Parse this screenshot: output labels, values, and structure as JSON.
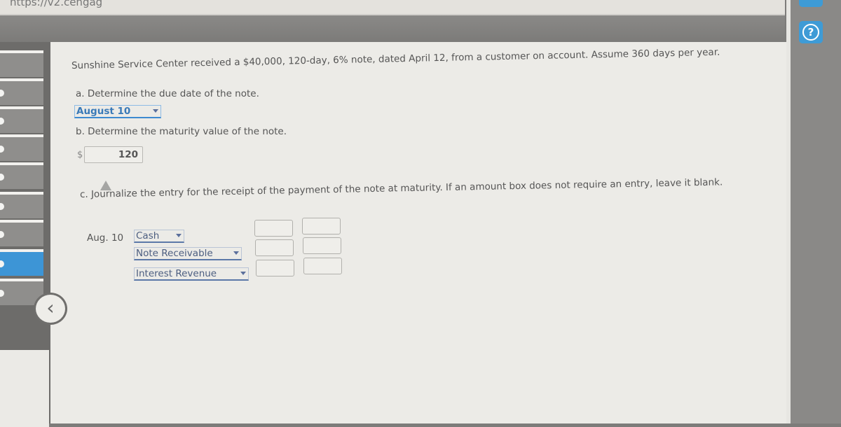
{
  "browser": {
    "url_fragment": "https://v2.cengag"
  },
  "help_button": {
    "icon": "question-circle-icon",
    "color": "#3e9bd6"
  },
  "sidebar": {
    "item_count": 9,
    "active_index": 7,
    "accent_color": "#3d95d6",
    "collapse_icon": "chevron-left-icon"
  },
  "problem": {
    "prompt": "Sunshine Service Center received a $40,000, 120-day, 6% note, dated April 12, from a customer on account. Assume 360 days per year.",
    "part_a": {
      "question": "a. Determine the due date of the note.",
      "selected": "August 10"
    },
    "part_b": {
      "question": "b. Determine the maturity value of the note.",
      "currency": "$",
      "value": "120"
    },
    "part_c": {
      "question": "c. Journalize the entry for the receipt of the payment of the note at maturity. If an amount box does not require an entry, leave it blank.",
      "date": "Aug. 10",
      "rows": [
        {
          "account": "Cash",
          "debit": "",
          "credit": ""
        },
        {
          "account": "Note Receivable",
          "debit": "",
          "credit": ""
        },
        {
          "account": "Interest Revenue",
          "debit": "",
          "credit": ""
        }
      ]
    }
  }
}
